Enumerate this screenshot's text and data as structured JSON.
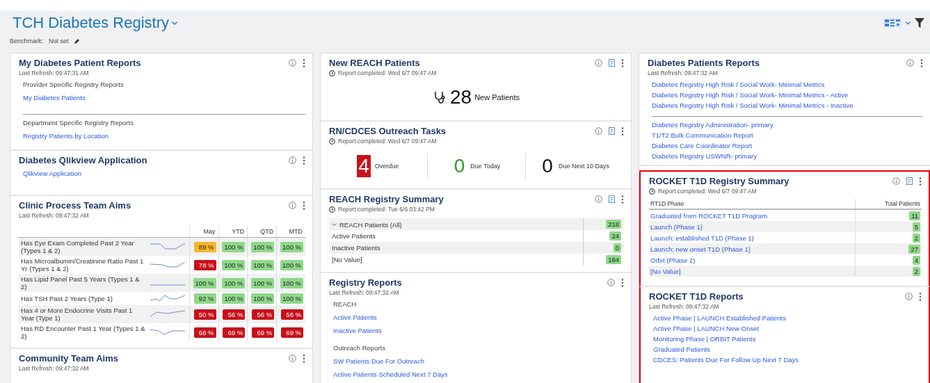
{
  "header": {
    "title": "TCH Diabetes Registry",
    "benchmark_label": "Benchmark:",
    "benchmark_value": "Not set"
  },
  "columns": [
    {
      "cards": [
        {
          "kind": "links",
          "title": "My Diabetes Patient Reports",
          "subtitle": "Last Refresh: 09:47:31 AM",
          "clock": false,
          "report_button": false,
          "highlighted": false,
          "sections": [
            {
              "divider": false,
              "heading": "Provider Specific Registry Reports",
              "links": [
                "My Diabetes Patients"
              ]
            },
            {
              "divider": true,
              "heading": "Department Specific Registry Reports",
              "links": [
                "Registry Patients by Location"
              ]
            }
          ]
        },
        {
          "kind": "links",
          "title": "Diabetes Qlikview Application",
          "clock": false,
          "report_button": false,
          "highlighted": false,
          "sections": [
            {
              "divider": false,
              "links": [
                "Qlikview Application"
              ]
            }
          ]
        },
        {
          "kind": "aims",
          "title": "Clinic Process Team Aims",
          "subtitle": "Last Refresh: 09:47:32 AM",
          "clock": false,
          "report_button": false,
          "highlighted": false,
          "columns": [
            "May",
            "YTD",
            "QTD",
            "MTD"
          ],
          "rows": [
            {
              "label": "Has Eye Exam Completed Past 2 Year (Types 1 & 2)",
              "values": [
                {
                  "text": "89 %",
                  "color": "#f8b62c"
                },
                {
                  "text": "100 %",
                  "color": "#8fd88a"
                },
                {
                  "text": "100 %",
                  "color": "#8fd88a"
                },
                {
                  "text": "100 %",
                  "color": "#8fd88a"
                }
              ]
            },
            {
              "label": "Has Microalbumin/Creatinine Ratio Past 1 Yr (Types 1 & 2)",
              "values": [
                {
                  "text": "78 %",
                  "color": "#c8101a"
                },
                {
                  "text": "100 %",
                  "color": "#8fd88a"
                },
                {
                  "text": "100 %",
                  "color": "#8fd88a"
                },
                {
                  "text": "100 %",
                  "color": "#8fd88a"
                }
              ]
            },
            {
              "label": "Has Lipid Panel Past 5 Years (Types 1 & 2)",
              "values": [
                {
                  "text": "100 %",
                  "color": "#8fd88a"
                },
                {
                  "text": "100 %",
                  "color": "#8fd88a"
                },
                {
                  "text": "100 %",
                  "color": "#8fd88a"
                },
                {
                  "text": "100 %",
                  "color": "#8fd88a"
                }
              ]
            },
            {
              "label": "Has TSH Past 2 Years (Type 1)",
              "values": [
                {
                  "text": "92 %",
                  "color": "#8fd88a"
                },
                {
                  "text": "100 %",
                  "color": "#8fd88a"
                },
                {
                  "text": "100 %",
                  "color": "#8fd88a"
                },
                {
                  "text": "100 %",
                  "color": "#8fd88a"
                }
              ]
            },
            {
              "label": "Has 4 or More Endocrine Visits Past 1 Year (Type 1)",
              "values": [
                {
                  "text": "50 %",
                  "color": "#c8101a"
                },
                {
                  "text": "56 %",
                  "color": "#c8101a"
                },
                {
                  "text": "56 %",
                  "color": "#c8101a"
                },
                {
                  "text": "56 %",
                  "color": "#c8101a"
                }
              ]
            },
            {
              "label": "Has RD Encounter Past 1 Year (Types 1 & 2)",
              "values": [
                {
                  "text": "68 %",
                  "color": "#c8101a"
                },
                {
                  "text": "69 %",
                  "color": "#c8101a"
                },
                {
                  "text": "69 %",
                  "color": "#c8101a"
                },
                {
                  "text": "69 %",
                  "color": "#c8101a"
                }
              ]
            }
          ]
        },
        {
          "kind": "links",
          "title": "Community Team Aims",
          "subtitle": "Last Refresh: 09:47:32 AM",
          "clock": false,
          "report_button": false,
          "highlighted": false
        }
      ]
    },
    {
      "cards": [
        {
          "kind": "metric",
          "title": "New REACH Patients",
          "subtitle": "Report completed: Wed 6/7 09:47 AM",
          "clock": true,
          "report_button": true,
          "highlighted": false,
          "value": "28",
          "label": "New Patients"
        },
        {
          "kind": "tasks",
          "title": "RN/CDCES Outreach Tasks",
          "subtitle": "Report completed: Wed 6/7 09:47 AM",
          "clock": true,
          "report_button": true,
          "highlighted": false,
          "items": [
            {
              "kind": "alert",
              "count": "4",
              "label": "Overdue"
            },
            {
              "kind": "positive",
              "count": "0",
              "label": "Due Today"
            },
            {
              "kind": "plain",
              "count": "0",
              "label": "Due Next 10 Days"
            }
          ]
        },
        {
          "kind": "tree",
          "title": "REACH Registry Summary",
          "subtitle": "Report completed: Tue 6/6 03:42 PM",
          "clock": true,
          "report_button": true,
          "highlighted": false,
          "root": {
            "label": "REACH Patients (All)",
            "value": "218",
            "expanded": true,
            "children": [
              {
                "label": "Active Patients",
                "value": "24"
              },
              {
                "label": "Inactive Patients",
                "value": "0"
              },
              {
                "label": "[No Value]",
                "value": "194"
              }
            ]
          }
        },
        {
          "kind": "links",
          "title": "Registry Reports",
          "subtitle": "Last Refresh: 09:47:32 AM",
          "clock": false,
          "report_button": false,
          "highlighted": false,
          "sections": [
            {
              "divider": false,
              "heading": "REACH",
              "links": [
                "Active Patients",
                "Inactive Patients"
              ]
            },
            {
              "divider": false,
              "heading": "Outreach Reports",
              "links": [
                "SW Patients Due For Outreach",
                "Active Patients Scheduled Next 7 Days"
              ]
            }
          ]
        }
      ]
    },
    {
      "cards": [
        {
          "kind": "links",
          "title": "Diabetes Patients Reports",
          "subtitle": "Last Refresh: 09:47:32 AM",
          "clock": false,
          "report_button": false,
          "highlighted": false,
          "sections": [
            {
              "divider": false,
              "links": [
                "Diabetes Registry High Risk / Social Work- Minimal Metrics",
                "Diabetes Registry High Risk / Social Work- Minimal Metrics - Active",
                "Diabetes Registry High Risk / Social Work- Minimal Metrics - Inactive"
              ]
            },
            {
              "divider": true,
              "links": [
                "Diabetes Registry Administration- primary",
                "T1/T2 Bulk Communication Report",
                "Diabetes Care Coordinator Report",
                "Diabetes Registry USWNR- primary"
              ]
            }
          ]
        },
        {
          "kind": "phases",
          "title": "ROCKET T1D Registry Summary",
          "subtitle": "Report completed: Wed 6/7 09:47 AM",
          "clock": true,
          "report_button": true,
          "highlighted": true,
          "columns": [
            "RT1D Phase",
            "Total Patients"
          ],
          "rows": [
            {
              "label": "Graduated from ROCKET T1D Program",
              "value": "11"
            },
            {
              "label": "Launch (Phase 1)",
              "value": "5"
            },
            {
              "label": "Launch: established T1D (Phase 1)",
              "value": "2"
            },
            {
              "label": "Launch: new onset T1D (Phase 1)",
              "value": "27"
            },
            {
              "label": "Orbit (Phase 2)",
              "value": "4"
            },
            {
              "label": "[No Value]",
              "value": "2"
            }
          ]
        },
        {
          "kind": "links",
          "title": "ROCKET T1D Reports",
          "subtitle": "Last Refresh: 09:47:32 AM",
          "clock": false,
          "report_button": false,
          "highlighted": true,
          "sections": [
            {
              "divider": false,
              "links": [
                "Active Phase | LAUNCH Established Patients",
                "Active Phase | LAUNCH New Onset",
                "Monitoring Phase | ORBIT Patients",
                "Graduated Patients",
                "CDCES: Patients Due For Follow Up Next 7 Days"
              ]
            }
          ]
        }
      ]
    }
  ]
}
